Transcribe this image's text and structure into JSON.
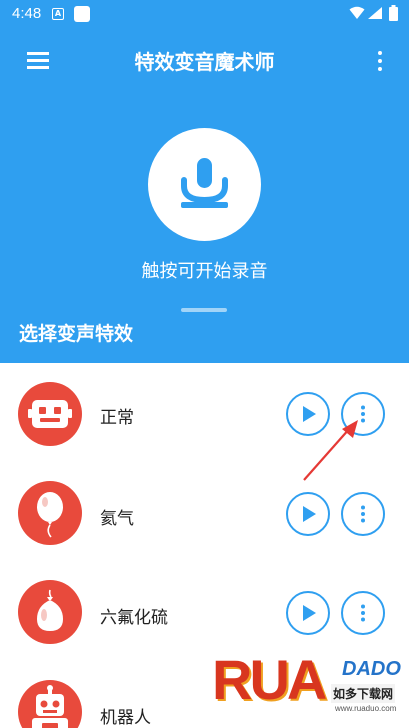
{
  "status_bar": {
    "time": "4:48",
    "notification_letter": "A"
  },
  "header": {
    "title": "特效变音魔术师",
    "record_hint": "触按可开始录音",
    "section_title": "选择变声特效",
    "background_color": "#2f9ff0"
  },
  "icons": {
    "menu": "hamburger-menu-icon",
    "more": "vertical-dots-icon",
    "record": "microphone-icon",
    "play": "play-icon",
    "options": "vertical-dots-icon"
  },
  "effects": [
    {
      "label": "正常",
      "avatar": "robot-face-icon"
    },
    {
      "label": "氦气",
      "avatar": "balloon-icon"
    },
    {
      "label": "六氟化硫",
      "avatar": "heavy-balloon-icon"
    },
    {
      "label": "机器人",
      "avatar": "robot-icon"
    }
  ],
  "watermark": {
    "logo_letters": "RUA",
    "logo_suffix": "DADO",
    "site_name": "如多下载网",
    "site_url": "www.ruaduo.com"
  },
  "colors": {
    "accent": "#2f9ff0",
    "avatar_red": "#e84a3c",
    "arrow_red": "#e53935"
  }
}
